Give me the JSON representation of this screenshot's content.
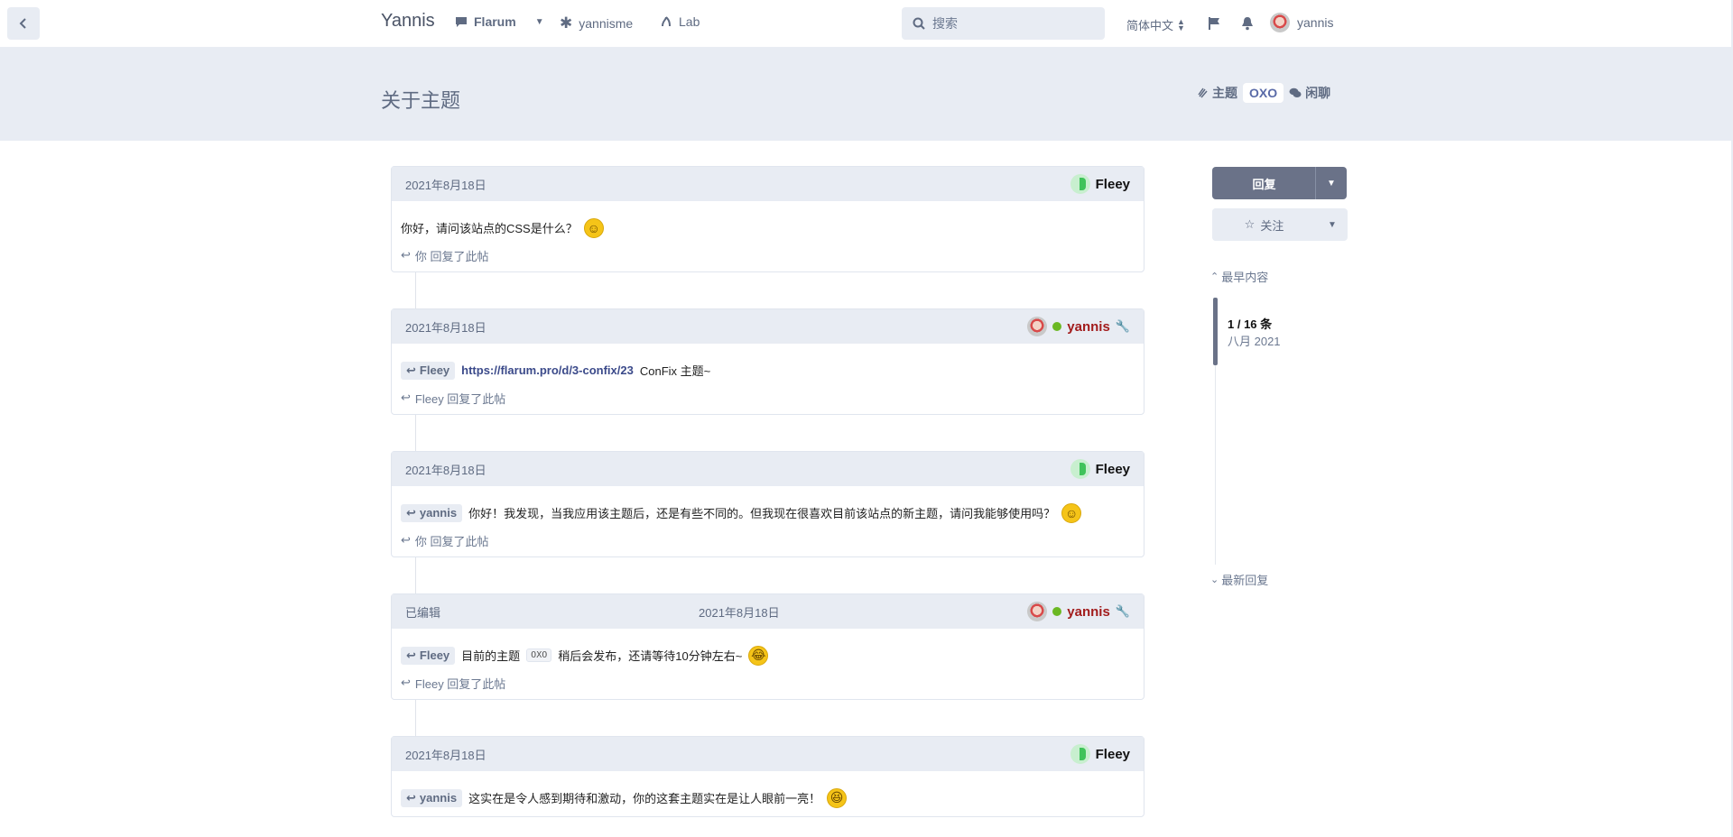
{
  "header": {
    "brand": "Yannis",
    "nav": [
      {
        "label": "Flarum",
        "icon": "comment-icon"
      },
      {
        "label": "yannisme",
        "icon": "asterisk-icon"
      },
      {
        "label": "Lab",
        "icon": "flask-icon"
      }
    ],
    "search_placeholder": "搜索",
    "language": "简体中文",
    "username": "yannis"
  },
  "hero": {
    "title": "关于主题",
    "tags": [
      "主题",
      "OXO",
      "闲聊"
    ]
  },
  "posts": [
    {
      "date": "2021年8月18日",
      "author": "Fleey",
      "text": "你好，请问该站点的CSS是什么？",
      "footer": "你 回复了此帖"
    },
    {
      "date": "2021年8月18日",
      "author": "yannis",
      "mention": "Fleey",
      "link": "https://flarum.pro/d/3-confix/23",
      "text": "ConFix 主题~",
      "footer": "Fleey 回复了此帖"
    },
    {
      "date": "2021年8月18日",
      "author": "Fleey",
      "mention": "yannis",
      "text": "你好！我发现，当我应用该主题后，还是有些不同的。但我现在很喜欢目前该站点的新主题，请问我能够使用吗？",
      "footer": "你 回复了此帖"
    },
    {
      "edited": "已编辑",
      "date": "2021年8月18日",
      "author": "yannis",
      "mention": "Fleey",
      "text_before": "目前的主题",
      "code": "OXO",
      "text_after": "稍后会发布，还请等待10分钟左右~",
      "footer": "Fleey 回复了此帖"
    },
    {
      "date": "2021年8月18日",
      "author": "Fleey",
      "mention": "yannis",
      "text": "这实在是令人感到期待和激动，你的这套主题实在是让人眼前一亮！"
    }
  ],
  "sidebar": {
    "reply_label": "回复",
    "follow_label": "关注",
    "earliest": "最早内容",
    "latest": "最新回复",
    "scrub_count": "1 / 16 条",
    "scrub_date": "八月 2021"
  }
}
